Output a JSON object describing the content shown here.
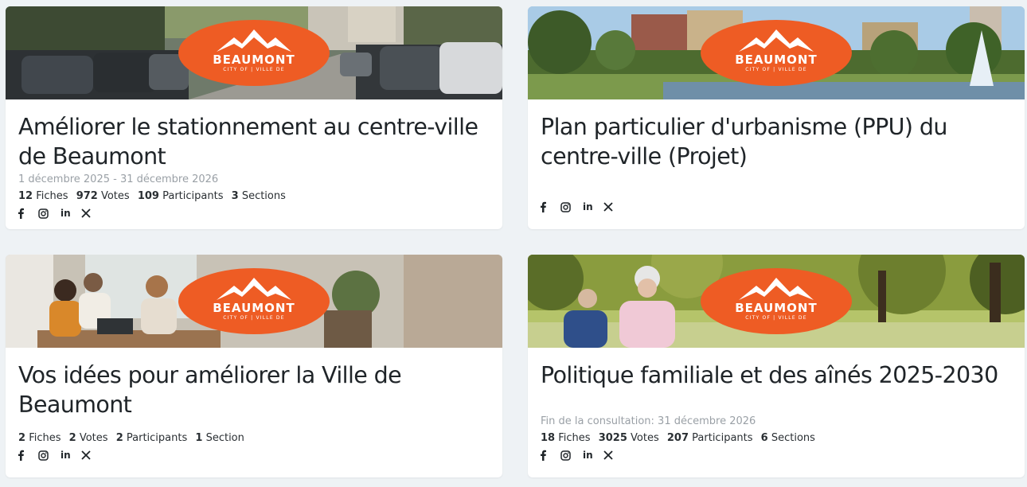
{
  "logo": {
    "brand": "BEAUMONT",
    "tagline": "CITY OF | VILLE DE",
    "color": "#ee5c24"
  },
  "cards": [
    {
      "title": "Améliorer le stationnement au centre-ville de Beaumont",
      "dates": "1 décembre 2025 - 31 décembre 2026",
      "stats": [
        {
          "value": "12",
          "label": "Fiches"
        },
        {
          "value": "972",
          "label": "Votes"
        },
        {
          "value": "109",
          "label": "Participants"
        },
        {
          "value": "3",
          "label": "Sections"
        }
      ],
      "image": "street-parked-cars"
    },
    {
      "title": "Plan particulier d'urbanisme (PPU) du centre-ville (Projet)",
      "dates": "",
      "stats": [],
      "image": "city-park-fountain"
    },
    {
      "title": "Vos idées pour améliorer la Ville de Beaumont",
      "dates": "",
      "stats": [
        {
          "value": "2",
          "label": "Fiches"
        },
        {
          "value": "2",
          "label": "Votes"
        },
        {
          "value": "2",
          "label": "Participants"
        },
        {
          "value": "1",
          "label": "Section"
        }
      ],
      "image": "people-meeting-table"
    },
    {
      "title": "Politique familiale et des aînés 2025-2030",
      "dates": "Fin de la consultation: 31 décembre 2026",
      "stats": [
        {
          "value": "18",
          "label": "Fiches"
        },
        {
          "value": "3025",
          "label": "Votes"
        },
        {
          "value": "207",
          "label": "Participants"
        },
        {
          "value": "6",
          "label": "Sections"
        }
      ],
      "image": "seniors-jogging-park"
    }
  ],
  "social": [
    "facebook-icon",
    "instagram-icon",
    "linkedin-icon",
    "x-icon"
  ],
  "social_linkedin_text": "in"
}
